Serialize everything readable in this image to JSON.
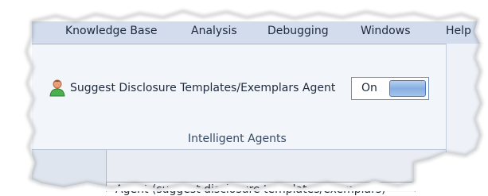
{
  "menu": {
    "items": [
      {
        "label": "Knowledge Base"
      },
      {
        "label": "Analysis"
      },
      {
        "label": "Debugging"
      },
      {
        "label": "Windows"
      },
      {
        "label": "Help"
      }
    ]
  },
  "ribbon": {
    "agent": {
      "icon": "person-icon",
      "label": "Suggest Disclosure Templates/Exemplars Agent",
      "toggle_value": "On"
    },
    "group_label": "Intelligent Agents"
  },
  "lower": {
    "tab_label": "Agent (suggest disclosure templates/exemplars)"
  },
  "colors": {
    "menubar": "#d2dced",
    "ribbon": "#f2f5fa",
    "toggle_border": "#6c8fbe",
    "toggle_thumb": "#86aee2"
  }
}
